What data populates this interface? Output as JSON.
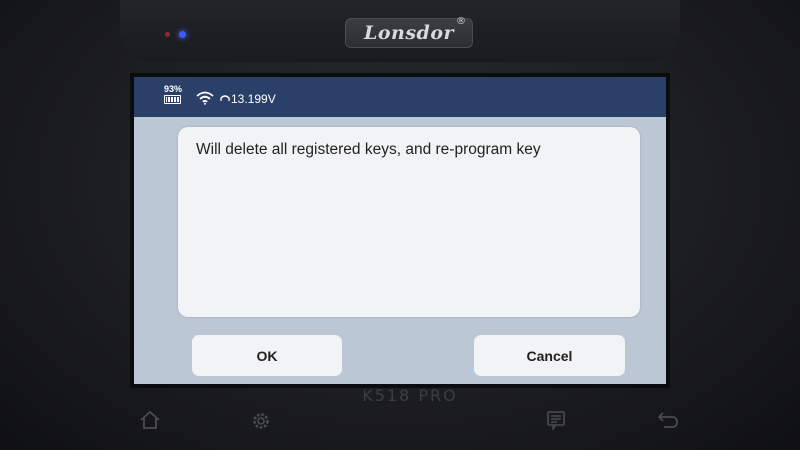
{
  "device": {
    "brand": "Lonsdor",
    "brand_mark": "®",
    "model": "K518 PRO"
  },
  "status_bar": {
    "battery_percent": "93%",
    "battery_icon": "battery-icon",
    "wifi_icon": "wifi-icon",
    "voltage_icon": "car-battery-icon",
    "voltage": "13.199V"
  },
  "dialog": {
    "message": "Will delete all registered keys, and re-program key",
    "ok_label": "OK",
    "cancel_label": "Cancel"
  },
  "hardware_buttons": [
    "home-icon",
    "settings-icon",
    "menu-icon",
    "back-icon"
  ],
  "colors": {
    "status_bar": "#2a4069",
    "screen_background": "#bcc7d6",
    "dialog_background": "#f1f3f4",
    "button_background": "#f2f3f4"
  }
}
